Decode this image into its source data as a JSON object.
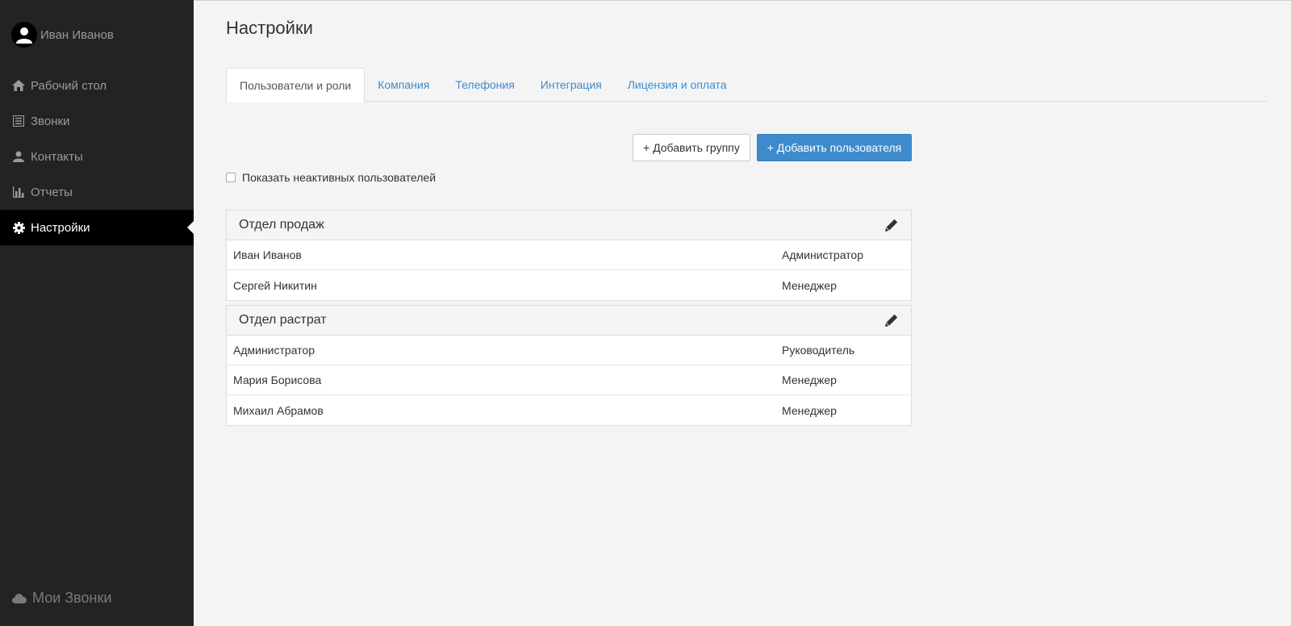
{
  "sidebar": {
    "user_name": "Иван Иванов",
    "items": [
      {
        "label": "Рабочий стол",
        "icon": "home-icon",
        "active": false
      },
      {
        "label": "Звонки",
        "icon": "list-icon",
        "active": false
      },
      {
        "label": "Контакты",
        "icon": "user-icon",
        "active": false
      },
      {
        "label": "Отчеты",
        "icon": "bar-chart-icon",
        "active": false
      },
      {
        "label": "Настройки",
        "icon": "gear-icon",
        "active": true
      }
    ],
    "brand": "Мои Звонки"
  },
  "main": {
    "title": "Настройки",
    "tabs": [
      {
        "label": "Пользователи и роли",
        "active": true
      },
      {
        "label": "Компания",
        "active": false
      },
      {
        "label": "Телефония",
        "active": false
      },
      {
        "label": "Интеграция",
        "active": false
      },
      {
        "label": "Лицензия и оплата",
        "active": false
      }
    ],
    "add_group_label": "+ Добавить группу",
    "add_user_label": "+ Добавить пользователя",
    "show_inactive_label": "Показать неактивных пользователей",
    "groups": [
      {
        "title": "Отдел продаж",
        "rows": [
          {
            "name": "Иван Иванов",
            "role": "Администратор"
          },
          {
            "name": "Сергей Никитин",
            "role": "Менеджер"
          }
        ]
      },
      {
        "title": "Отдел растрат",
        "rows": [
          {
            "name": "Администратор",
            "role": "Руководитель"
          },
          {
            "name": "Мария Борисова",
            "role": "Менеджер"
          },
          {
            "name": "Михаил Абрамов",
            "role": "Менеджер"
          }
        ]
      }
    ]
  },
  "colors": {
    "accent": "#3d8bcd",
    "sidebar_bg": "#232323",
    "page_bg": "#f4f4f4"
  }
}
